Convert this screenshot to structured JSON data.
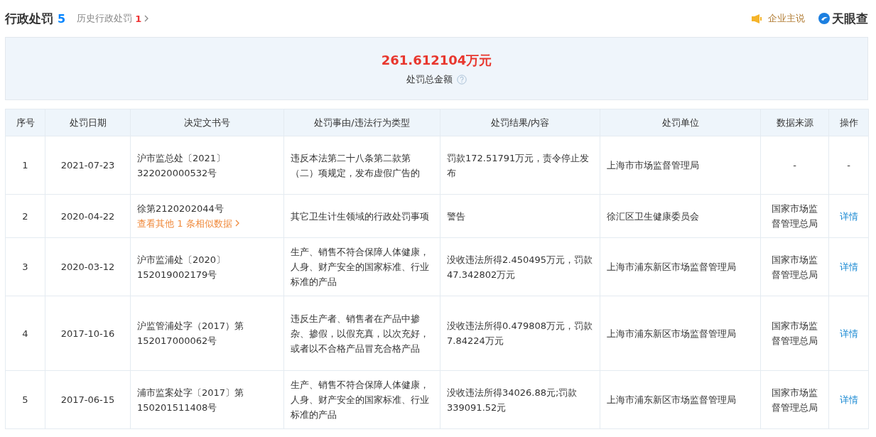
{
  "header": {
    "title": "行政处罚",
    "count": "5",
    "history_label": "历史行政处罚",
    "history_count": "1",
    "announce": "企业主说",
    "brand": "天眼查"
  },
  "summary": {
    "amount": "261.612104",
    "unit": "万元",
    "label": "处罚总金额"
  },
  "table": {
    "columns": [
      "序号",
      "处罚日期",
      "决定文书号",
      "处罚事由/违法行为类型",
      "处罚结果/内容",
      "处罚单位",
      "数据来源",
      "操作"
    ],
    "rows": [
      {
        "index": "1",
        "date": "2021-07-23",
        "doc": "沪市监总处〔2021〕322020000532号",
        "similar": null,
        "reason": "违反本法第二十八条第二款第（二）项规定，发布虚假广告的",
        "result": "罚款172.51791万元，责令停止发布",
        "unit": "上海市市场监督管理局",
        "source": "-",
        "action": {
          "kind": "text",
          "label": "-"
        }
      },
      {
        "index": "2",
        "date": "2020-04-22",
        "doc": "徐第2120202044号",
        "similar": "查看其他 1 条相似数据",
        "reason": "其它卫生计生领域的行政处罚事项",
        "result": "警告",
        "unit": "徐汇区卫生健康委员会",
        "source": "国家市场监督管理总局",
        "action": {
          "kind": "link",
          "label": "详情"
        }
      },
      {
        "index": "3",
        "date": "2020-03-12",
        "doc": "沪市监浦处〔2020〕152019002179号",
        "similar": null,
        "reason": "生产、销售不符合保障人体健康，人身、财产安全的国家标准、行业标准的产品",
        "result": "没收违法所得2.450495万元，罚款47.342802万元",
        "unit": "上海市浦东新区市场监督管理局",
        "source": "国家市场监督管理总局",
        "action": {
          "kind": "link",
          "label": "详情"
        }
      },
      {
        "index": "4",
        "date": "2017-10-16",
        "doc": "沪监管浦处字（2017）第152017000062号",
        "similar": null,
        "reason": "违反生产者、销售者在产品中掺杂、掺假，以假充真，以次充好，或者以不合格产品冒充合格产品",
        "result": "没收违法所得0.479808万元，罚款7.84224万元",
        "unit": "上海市浦东新区市场监督管理局",
        "source": "国家市场监督管理总局",
        "action": {
          "kind": "link",
          "label": "详情"
        }
      },
      {
        "index": "5",
        "date": "2017-06-15",
        "doc": "浦市监案处字〔2017〕第150201511408号",
        "similar": null,
        "reason": "生产、销售不符合保障人体健康，人身、财产安全的国家标准、行业标准的产品",
        "result": "没收违法所得34026.88元;罚款339091.52元",
        "unit": "上海市浦东新区市场监督管理局",
        "source": "国家市场监督管理总局",
        "action": {
          "kind": "link",
          "label": "详情"
        }
      }
    ]
  }
}
